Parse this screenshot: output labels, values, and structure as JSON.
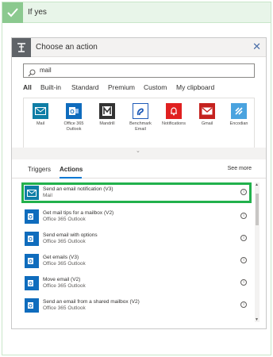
{
  "condition": {
    "label": "If yes"
  },
  "card": {
    "title": "Choose an action"
  },
  "search": {
    "value": "mail"
  },
  "tabs": [
    {
      "label": "All",
      "active": true
    },
    {
      "label": "Built-in"
    },
    {
      "label": "Standard"
    },
    {
      "label": "Premium"
    },
    {
      "label": "Custom"
    },
    {
      "label": "My clipboard"
    }
  ],
  "connectors": [
    {
      "name": "Mail",
      "icon": "mail-icon",
      "color": "#0f7ea6"
    },
    {
      "name": "Office 365 Outlook",
      "icon": "outlook-icon",
      "color": "#0f6cbd"
    },
    {
      "name": "Mandrill",
      "icon": "mandrill-icon",
      "color": "#333333"
    },
    {
      "name": "Benchmark Email",
      "icon": "benchmark-icon",
      "color": "#1e5bb8"
    },
    {
      "name": "Notifications",
      "icon": "bell-icon",
      "color": "#e02020"
    },
    {
      "name": "Gmail",
      "icon": "gmail-icon",
      "color": "#c5221f"
    },
    {
      "name": "Encodian",
      "icon": "encodian-icon",
      "color": "#4aa3df"
    }
  ],
  "subtabs": {
    "triggers": "Triggers",
    "actions": "Actions",
    "see_more": "See more"
  },
  "actions": [
    {
      "title": "Send an email notification (V3)",
      "connector": "Mail",
      "selected": true
    },
    {
      "title": "Get mail tips for a mailbox (V2)",
      "connector": "Office 365 Outlook"
    },
    {
      "title": "Send email with options",
      "connector": "Office 365 Outlook"
    },
    {
      "title": "Get emails (V3)",
      "connector": "Office 365 Outlook"
    },
    {
      "title": "Move email (V2)",
      "connector": "Office 365 Outlook"
    },
    {
      "title": "Send an email from a shared mailbox (V2)",
      "connector": "Office 365 Outlook"
    }
  ],
  "colors": {
    "accent": "#0078d4",
    "highlight": "#22b14c",
    "condition_green": "#8bc98f"
  }
}
